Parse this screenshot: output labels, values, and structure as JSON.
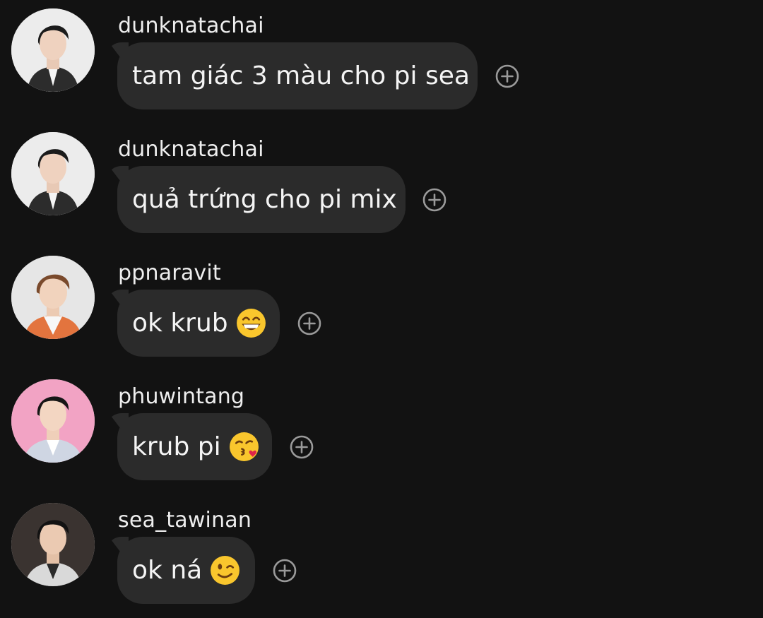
{
  "messages": [
    {
      "username": "dunknatachai",
      "text": "tam giác 3 màu cho pi sea",
      "emoji": null
    },
    {
      "username": "dunknatachai",
      "text": "quả trứng cho pi mix",
      "emoji": null
    },
    {
      "username": "ppnaravit",
      "text": "ok krub",
      "emoji": "grinning-face-icon"
    },
    {
      "username": "phuwintang",
      "text": "krub pi",
      "emoji": "face-blowing-kiss-icon"
    },
    {
      "username": "sea_tawinan",
      "text": "ok ná",
      "emoji": "winking-face-icon"
    }
  ],
  "colors": {
    "background": "#121212",
    "bubble": "#2b2b2b",
    "text": "#f4f4f4",
    "icon": "#9a9a9a"
  },
  "icons": {
    "react": "add-reaction-icon"
  }
}
